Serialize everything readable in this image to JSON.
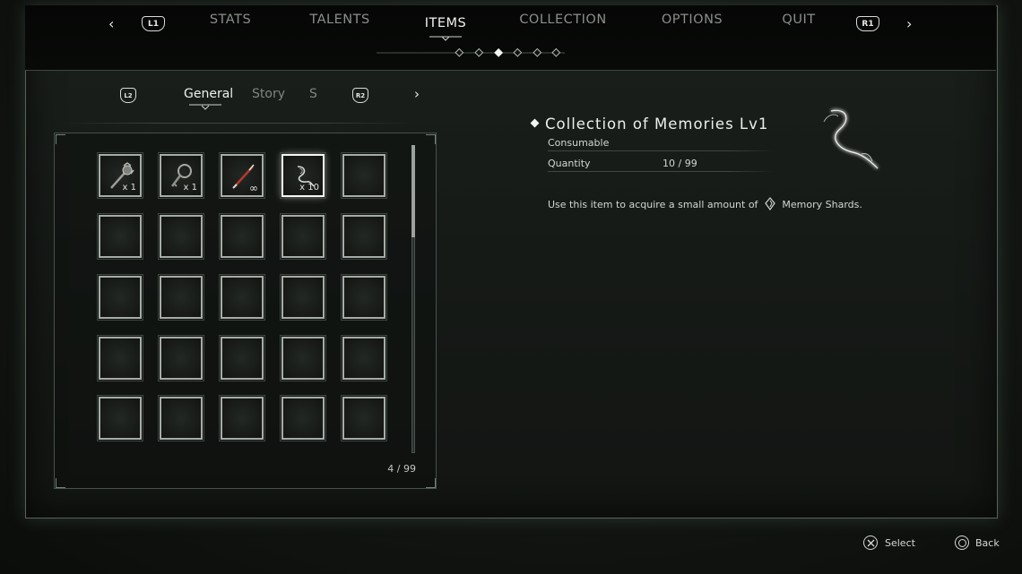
{
  "nav": {
    "left_bumper": "L1",
    "right_bumper": "R1",
    "tabs": [
      "STATS",
      "TALENTS",
      "ITEMS",
      "COLLECTION",
      "OPTIONS",
      "QUIT"
    ],
    "active_tab": "ITEMS"
  },
  "subnav": {
    "left_trigger": "L2",
    "right_trigger": "R2",
    "tabs": [
      "General",
      "Story",
      "S"
    ],
    "active_tab": "General"
  },
  "inventory": {
    "slots": [
      {
        "icon": "mace-icon",
        "qty": "x 1"
      },
      {
        "icon": "key-ring-icon",
        "qty": "x 1"
      },
      {
        "icon": "red-blade-icon",
        "qty": "∞"
      },
      {
        "icon": "memory-wisp-icon",
        "qty": "x 10",
        "selected": true
      }
    ],
    "count": "4 / 99"
  },
  "detail": {
    "title": "Collection of Memories Lv1",
    "type": "Consumable",
    "quantity_label": "Quantity",
    "quantity_value": "10 / 99",
    "description_before": "Use this item to acquire a small amount of",
    "description_after": "Memory Shards."
  },
  "hints": {
    "select": "Select",
    "back": "Back"
  },
  "colors": {
    "frame": "#56635a",
    "active_text": "#f0f2ef",
    "inactive_text": "#8a8f8b"
  }
}
